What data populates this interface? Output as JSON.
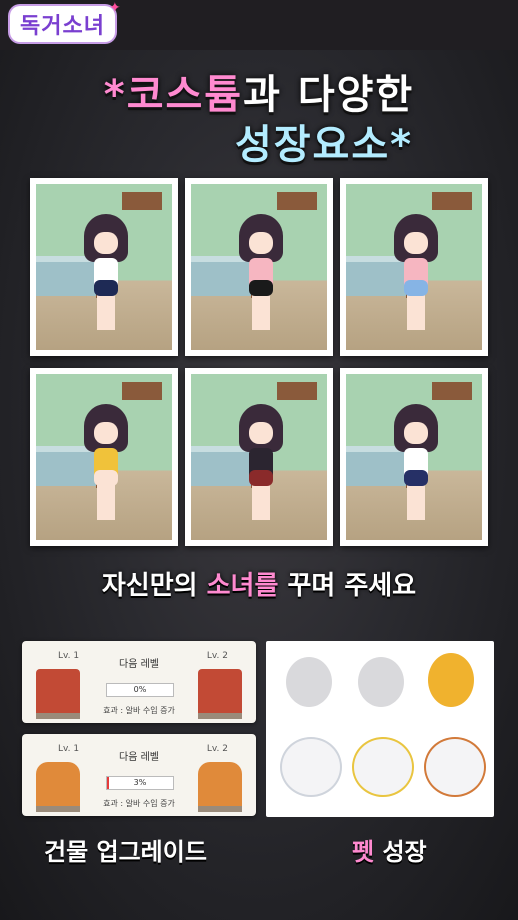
{
  "logo": {
    "text": "독거소녀"
  },
  "headline": {
    "line1_pre": "*",
    "line1_highlight": "코스튬",
    "line1_post": "과 다양한",
    "line2": "성장요소*"
  },
  "gallery": {
    "caption_pre": "자신만의 ",
    "caption_highlight": "소녀를",
    "caption_post": " 꾸며 주세요",
    "outfits": [
      {
        "top": "#ffffff",
        "bottom": "#1e2a55"
      },
      {
        "top": "#f6b6c1",
        "bottom": "#1a1a1a"
      },
      {
        "top": "#f6b6c1",
        "bottom": "#86b4e5"
      },
      {
        "top": "#f0c23a",
        "bottom": "#fbe3d5"
      },
      {
        "top": "#2b2530",
        "bottom": "#8a2a2a"
      },
      {
        "top": "#ffffff",
        "bottom": "#263066"
      }
    ]
  },
  "buildings": {
    "panels": [
      {
        "lv_left": "Lv. 1",
        "lv_right": "Lv. 2",
        "next_label": "다음 레벨",
        "percent_text": "0%",
        "progress": 0,
        "effect": "효과 : 알바 수입 증가",
        "color": "#c24a35"
      },
      {
        "lv_left": "Lv. 1",
        "lv_right": "Lv. 2",
        "next_label": "다음 레벨",
        "percent_text": "3%",
        "progress": 0.03,
        "effect": "효과 : 알바 수입 증가",
        "color": "#e08a3a"
      }
    ],
    "label": "건물 업그레이드"
  },
  "pets": {
    "label_highlight": "펫",
    "label_post": " 성장"
  },
  "colors": {
    "accent_pink": "#ff8ad0",
    "accent_blue": "#b3ecff",
    "logo_purple": "#7a3fd0"
  }
}
